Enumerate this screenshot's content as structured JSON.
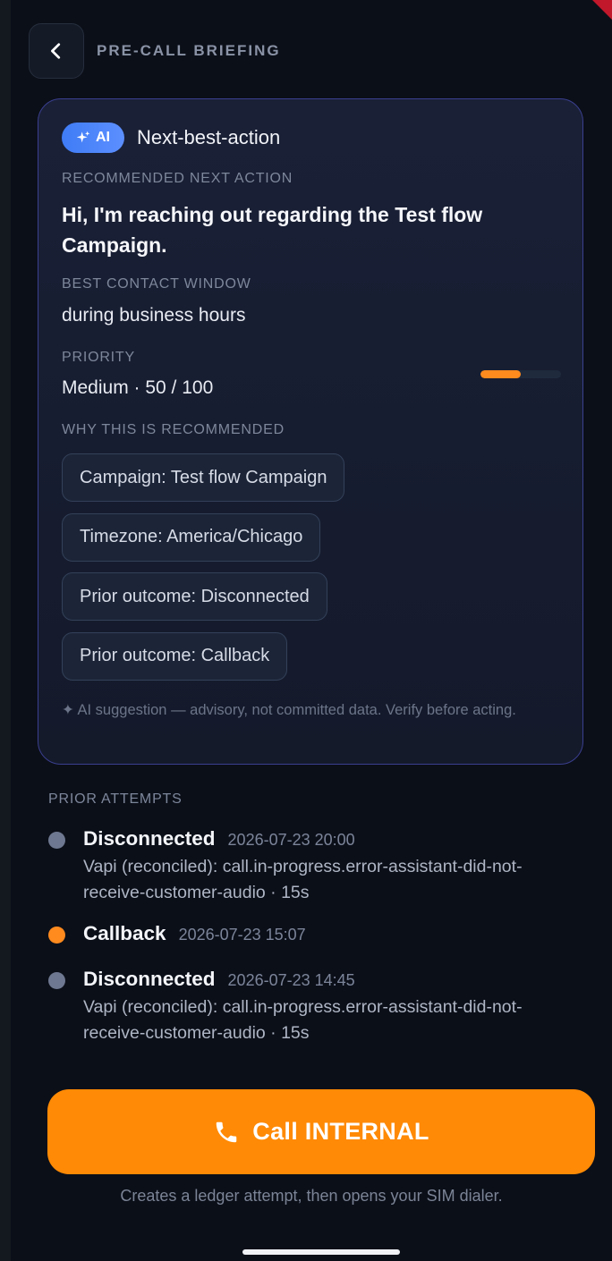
{
  "header": {
    "title": "PRE-CALL BRIEFING"
  },
  "card": {
    "badge_label": "AI",
    "title": "Next-best-action",
    "recommended_label": "RECOMMENDED NEXT ACTION",
    "recommended_text": "Hi, I'm reaching out regarding the Test flow Campaign.",
    "window_label": "BEST CONTACT WINDOW",
    "window_text": "during business hours",
    "priority_label": "PRIORITY",
    "priority_text": "Medium · 50 / 100",
    "priority_value": 50,
    "priority_max": 100,
    "why_label": "WHY THIS IS RECOMMENDED",
    "reasons": [
      "Campaign: Test flow Campaign",
      "Timezone: America/Chicago",
      "Prior outcome: Disconnected",
      "Prior outcome: Callback"
    ],
    "disclaimer": "✦ AI suggestion — advisory, not committed data. Verify before acting."
  },
  "prior_attempts": {
    "label": "PRIOR ATTEMPTS",
    "items": [
      {
        "status": "Disconnected",
        "time": "2026-07-23 20:00",
        "detail": "Vapi (reconciled): call.in-progress.error-assistant-did-not-receive-customer-audio · 15s",
        "dot_color": "#6e7890"
      },
      {
        "status": "Callback",
        "time": "2026-07-23 15:07",
        "detail": "",
        "dot_color": "#ff8a1e"
      },
      {
        "status": "Disconnected",
        "time": "2026-07-23 14:45",
        "detail": "Vapi (reconciled): call.in-progress.error-assistant-did-not-receive-customer-audio · 15s",
        "dot_color": "#6e7890"
      }
    ]
  },
  "call": {
    "button_label": "Call INTERNAL",
    "note": "Creates a ledger attempt, then opens your SIM dialer."
  },
  "colors": {
    "accent": "#ff8a05",
    "ai_badge": "#4a84fa",
    "card_border": "#3a3f8f"
  },
  "icons": {
    "back": "chevron-left-icon",
    "ai": "sparkle-icon",
    "call": "phone-icon"
  }
}
